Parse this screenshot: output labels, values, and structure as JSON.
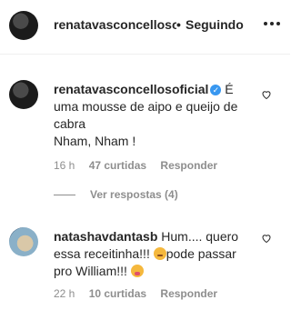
{
  "header": {
    "username": "renatavasconcellosoficial",
    "separator": "•",
    "follow_status": "Seguindo",
    "more_icon": "more-horizontal-icon"
  },
  "comments": [
    {
      "username": "renatavasconcellosoficial",
      "verified": true,
      "text_line1": " É",
      "text_line2": "uma mousse de aipo e queijo de",
      "text_line3": "cabra",
      "text_line4": "Nham, Nham !",
      "time": "16 h",
      "likes": "47 curtidas",
      "reply": "Responder",
      "view_replies": "Ver respostas (4)"
    },
    {
      "username": "natashavdantasb",
      "text_line1": " Hum.... quero",
      "text_line2": "essa receitinha!!! ",
      "text_line2b": "pode passar",
      "text_line3": "pro William!!! ",
      "time": "22 h",
      "likes": "10 curtidas",
      "reply": "Responder"
    }
  ]
}
